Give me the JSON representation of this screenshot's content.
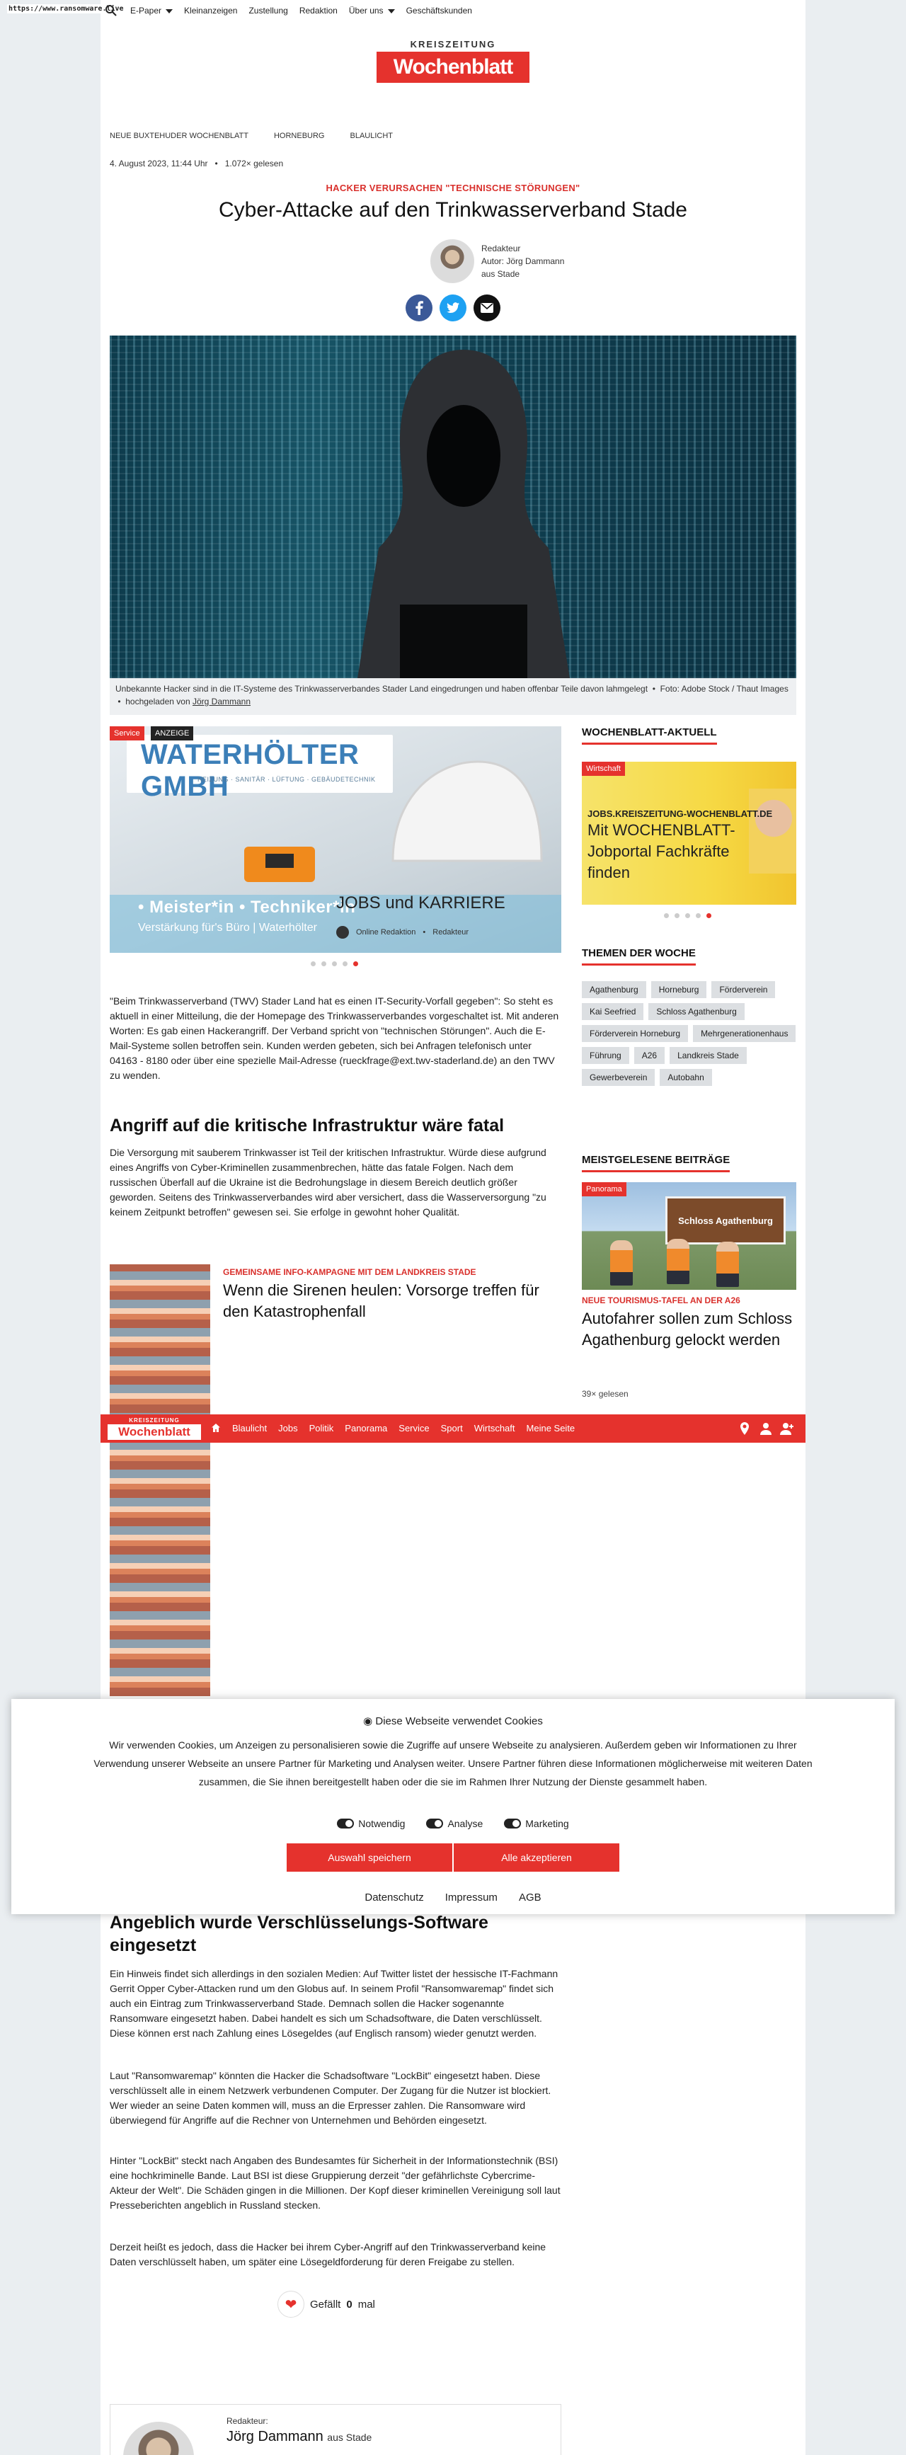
{
  "top_nav": {
    "url": "https://www.ransomware.live",
    "links": [
      "E-Paper",
      "Kleinanzeigen",
      "Zustellung",
      "Redaktion",
      "Über uns",
      "Geschäftskunden"
    ]
  },
  "logo": {
    "top": "KREISZEITUNG",
    "main": "Wochenblatt"
  },
  "breadcrumb": [
    "NEUE BUXTEHUDER WOCHENBLATT",
    "HORNEBURG",
    "BLAULICHT"
  ],
  "meta": {
    "date": "4. August 2023, 11:44 Uhr",
    "separator": "•",
    "reads": "1.072× gelesen"
  },
  "article": {
    "kicker": "HACKER VERURSACHEN \"TECHNISCHE STÖRUNGEN\"",
    "title": "Cyber-Attacke auf den Trinkwasserverband Stade",
    "author_role": "Redakteur",
    "author_line": "Autor: Jörg Dammann",
    "author_place": "aus Stade",
    "caption": "Unbekannte Hacker sind in die IT-Systeme des Trinkwasserverbandes Stader Land eingedrungen und haben offenbar Teile davon lahmgelegt",
    "caption_sep": "•",
    "caption_foto": "Foto: Adobe Stock / Thaut Images",
    "caption_upload_prefix": "hochgeladen von",
    "caption_uploader": "Jörg Dammann",
    "p1": "\"Beim Trinkwasserverband (TWV) Stader Land hat es einen IT-Security-Vorfall gegeben\": So steht es aktuell in einer Mitteilung, die der Homepage des Trinkwasserverbandes vorgeschaltet ist. Mit anderen Worten: Es gab einen Hackerangriff. Der Verband spricht von \"technischen Störungen\". Auch die E-Mail-Systeme sollen betroffen sein. Kunden werden gebeten, sich bei Anfragen telefonisch unter 04163 - 8180 oder über eine spezielle Mail-Adresse (rueckfrage@ext.twv-staderland.de) an den TWV zu wenden.",
    "h2_1": "Angriff auf die kritische Infrastruktur wäre fatal",
    "p2": "Die Versorgung mit sauberem Trinkwasser ist Teil der kritischen Infrastruktur. Würde diese aufgrund eines Angriffs von Cyber-Kriminellen zusammenbrechen, hätte das fatale Folgen. Nach dem russischen Überfall auf die Ukraine ist die Bedrohungslage in diesem Bereich deutlich größer geworden. Seitens des Trinkwasserverbandes wird aber versichert, dass die Wasserversorgung \"zu keinem Zeitpunkt betroffen\" gewesen sei. Sie erfolge in gewohnt hoher Qualität.",
    "h2_2": "Angeblich wurde Verschlüsselungs-Software eingesetzt",
    "p3": "Ein Hinweis findet sich allerdings in den sozialen Medien: Auf Twitter listet der hessische IT-Fachmann Gerrit Opper Cyber-Attacken rund um den Globus auf. In seinem Profil \"Ransomwaremap\" findet sich auch ein Eintrag zum Trinkwasserverband Stade. Demnach sollen die Hacker sogenannte Ransomware eingesetzt haben. Dabei handelt es sich um Schadsoftware, die Daten verschlüsselt. Diese können erst nach Zahlung eines Lösegeldes (auf Englisch ransom) wieder genutzt werden.",
    "p4": "Laut \"Ransomwaremap\" könnten die Hacker die Schadsoftware \"LockBit\" eingesetzt haben. Diese verschlüsselt alle in einem Netzwerk verbundenen Computer. Der Zugang für die Nutzer ist blockiert. Wer wieder an seine Daten kommen will, muss an die Erpresser zahlen. Die Ransomware wird überwiegend für Angriffe auf die Rechner von Unternehmen und Behörden eingesetzt.",
    "p5": "Hinter \"LockBit\" steckt nach Angaben des Bundesamtes für Sicherheit in der Informationstechnik (BSI) eine hochkriminelle Bande. Laut BSI ist diese Gruppierung derzeit \"der gefährlichste Cybercrime-Akteur der Welt\". Die Schäden gingen in die Millionen. Der Kopf dieser kriminellen Vereinigung soll laut Presseberichten angeblich in Russland stecken.",
    "p6": "Derzeit heißt es jedoch, dass die Hacker bei ihrem Cyber-Angriff auf den Trinkwasserverband keine Daten verschlüsselt haben, um später eine Lösegeldforderung für deren Freigabe zu stellen.",
    "like_prefix": "Gefällt",
    "like_count": "0",
    "like_suffix": "mal"
  },
  "ad_slider": {
    "tag1": "Service",
    "tag2": "ANZEIGE",
    "brand": "WATERHÖLTER GMBH",
    "brand_sub": "HEIZUNG · SANITÄR · LÜFTUNG · GEBÄUDETECHNIK",
    "banner": "• Meister*in  • Techniker*in",
    "banner_sub": "Verstärkung für's Büro | Waterhölter",
    "title": "JOBS und KARRIERE",
    "byline": "Online Redaktion",
    "byline_sep": "•",
    "byline_role": "Redakteur"
  },
  "teaser": {
    "kicker": "GEMEINSAME INFO-KAMPAGNE MIT DEM LANDKREIS STADE",
    "title": "Wenn die Sirenen heulen: Vorsorge treffen für den Katastrophenfall"
  },
  "sidebar": {
    "aktuell_heading": "WOCHENBLATT-AKTUELL",
    "aktuell_tag": "Wirtschaft",
    "aktuell_kicker": "JOBS.KREISZEITUNG-WOCHENBLATT.DE",
    "aktuell_title": "Mit WOCHENBLATT-Jobportal Fachkräfte finden",
    "themen_heading": "THEMEN DER WOCHE",
    "themen": [
      "Agathenburg",
      "Horneburg",
      "Förderverein",
      "Kai Seefried",
      "Schloss Agathenburg",
      "Förderverein Horneburg",
      "Mehrgenerationenhaus",
      "Führung",
      "A26",
      "Landkreis Stade",
      "Gewerbeverein",
      "Autobahn"
    ],
    "meist_heading": "MEISTGELESENE BEITRÄGE",
    "meist_tag": "Panorama",
    "meist_sign": "Schloss Agathenburg",
    "meist_kicker": "NEUE TOURISMUS-TAFEL AN DER A26",
    "meist_title": "Autofahrer sollen zum Schloss Agathenburg gelockt werden",
    "meist_reads": "39× gelesen"
  },
  "red_nav": {
    "logo_top": "KREISZEITUNG",
    "logo_main": "Wochenblatt",
    "items": [
      "Blaulicht",
      "Jobs",
      "Politik",
      "Panorama",
      "Service",
      "Sport",
      "Wirtschaft",
      "Meine Seite"
    ]
  },
  "cookie": {
    "title": "Diese Webseite verwendet Cookies",
    "text": "Wir verwenden Cookies, um Anzeigen zu personalisieren sowie die Zugriffe auf unsere Webseite zu analysieren. Außerdem geben wir Informationen zu Ihrer Verwendung unserer Webseite an unsere Partner für Marketing und Analysen weiter. Unsere Partner führen diese Informationen möglicherweise mit weiteren Daten zusammen, die Sie ihnen bereitgestellt haben oder die sie im Rahmen Ihrer Nutzung der Dienste gesammelt haben.",
    "toggles": [
      "Notwendig",
      "Analyse",
      "Marketing"
    ],
    "btn_save": "Auswahl speichern",
    "btn_accept": "Alle akzeptieren",
    "links": [
      "Datenschutz",
      "Impressum",
      "AGB"
    ]
  },
  "author_box": {
    "role": "Redakteur:",
    "name": "Jörg Dammann",
    "place": "aus Stade"
  },
  "colors": {
    "accent": "#e5322d",
    "facebook": "#3b5998",
    "twitter": "#1da1f2",
    "mail": "#111111"
  }
}
